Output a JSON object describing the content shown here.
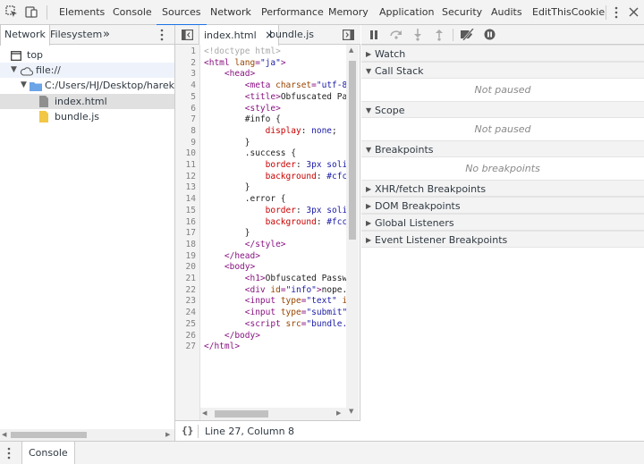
{
  "toolbar": {
    "tabs": [
      "Elements",
      "Console",
      "Sources",
      "Network",
      "Performance",
      "Memory",
      "Application",
      "Security",
      "Audits",
      "EditThisCookie"
    ],
    "active_tab": "Sources",
    "more_icon": "more-vertical-icon",
    "close_icon": "close-icon"
  },
  "navigator": {
    "tabs": [
      "Network",
      "Filesystem"
    ],
    "more": "»",
    "tree": [
      {
        "label": "top",
        "icon": "frame-icon"
      },
      {
        "label": "file://",
        "icon": "cloud-icon"
      },
      {
        "label": "C:/Users/HJ/Desktop/harekaze/",
        "icon": "folder-icon"
      },
      {
        "label": "index.html",
        "icon": "file-html-icon"
      },
      {
        "label": "bundle.js",
        "icon": "file-js-icon"
      }
    ]
  },
  "editor": {
    "tabs": [
      {
        "label": "index.html",
        "close": "×"
      },
      {
        "label": "bundle.js"
      }
    ],
    "status": "Line 27, Column 8",
    "format_icon": "{}",
    "line_numbers": [
      "1",
      "2",
      "3",
      "4",
      "5",
      "6",
      "7",
      "8",
      "9",
      "10",
      "11",
      "12",
      "13",
      "14",
      "15",
      "16",
      "17",
      "18",
      "19",
      "20",
      "21",
      "22",
      "23",
      "24",
      "25",
      "26",
      "27"
    ]
  },
  "debugger": {
    "sections": [
      {
        "label": "Watch",
        "open": false
      },
      {
        "label": "Call Stack",
        "open": true,
        "empty": "Not paused"
      },
      {
        "label": "Scope",
        "open": true,
        "empty": "Not paused"
      },
      {
        "label": "Breakpoints",
        "open": true,
        "empty": "No breakpoints"
      },
      {
        "label": "XHR/fetch Breakpoints",
        "open": false
      },
      {
        "label": "DOM Breakpoints",
        "open": false
      },
      {
        "label": "Global Listeners",
        "open": false
      },
      {
        "label": "Event Listener Breakpoints",
        "open": false
      }
    ]
  },
  "drawer": {
    "tab": "Console"
  },
  "colors": {
    "accent": "#1a73e8",
    "tag": "#881280",
    "attr": "#994500",
    "value": "#1a1aa6"
  }
}
